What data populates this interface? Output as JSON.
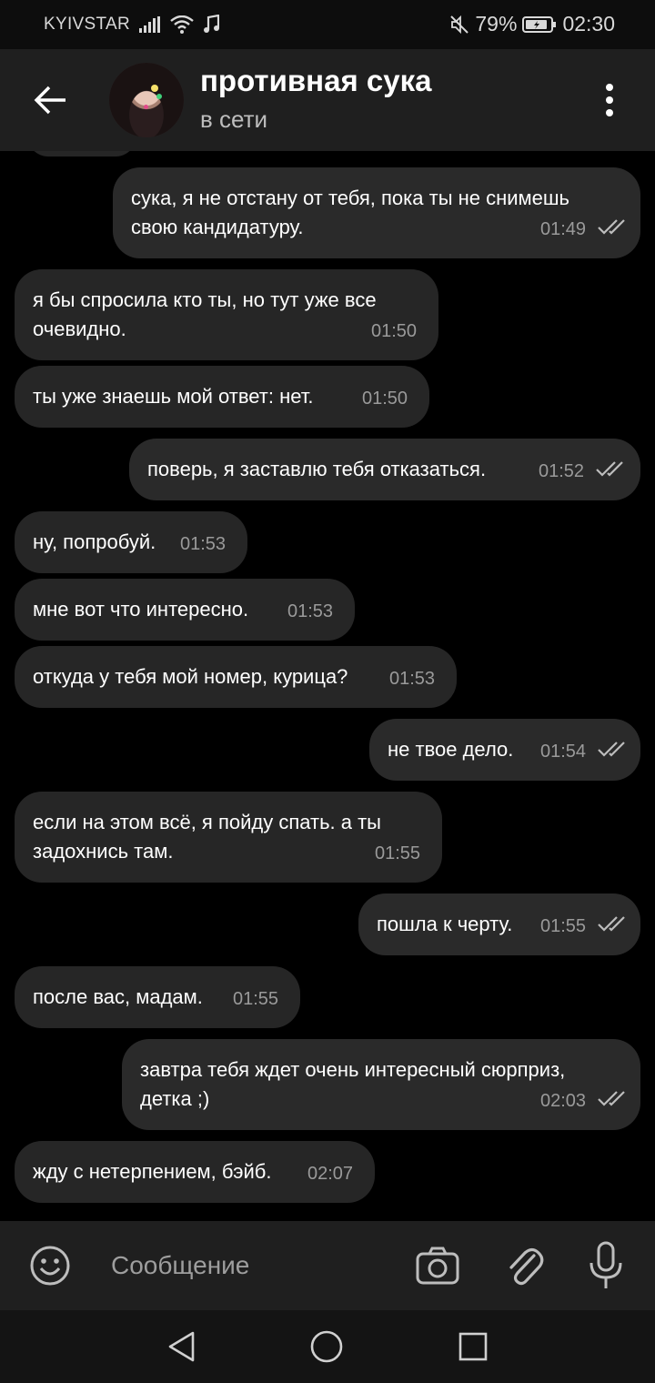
{
  "status_bar": {
    "carrier": "KYIVSTAR",
    "battery": "79%",
    "time": "02:30"
  },
  "header": {
    "contact_name": "противная сука",
    "status": "в сети"
  },
  "messages": [
    {
      "side": "out",
      "text": "сука, я не отстану от тебя, пока ты не снимешь\nсвою кандидатуру.",
      "time": "01:49",
      "read": true
    },
    {
      "side": "in",
      "text": "я бы спросила кто ты, но тут уже все\nочевидно.",
      "time": "01:50"
    },
    {
      "side": "in",
      "text": "ты уже знаешь мой ответ: нет.",
      "time": "01:50"
    },
    {
      "side": "out",
      "text": "поверь, я заставлю тебя отказаться.",
      "time": "01:52",
      "read": true
    },
    {
      "side": "in",
      "text": "ну, попробуй.",
      "time": "01:53"
    },
    {
      "side": "in",
      "text": "мне вот что интересно.",
      "time": "01:53"
    },
    {
      "side": "in",
      "text": "откуда у тебя мой номер, курица?",
      "time": "01:53"
    },
    {
      "side": "out",
      "text": "не твое дело.",
      "time": "01:54",
      "read": true
    },
    {
      "side": "in",
      "text": "если на этом всё, я пойду спать. а ты\nзадохнись там.",
      "time": "01:55"
    },
    {
      "side": "out",
      "text": "пошла к черту.",
      "time": "01:55",
      "read": true
    },
    {
      "side": "in",
      "text": "после вас, мадам.",
      "time": "01:55"
    },
    {
      "side": "out",
      "text": "завтра тебя ждет очень интересный сюрприз,\nдетка ;)",
      "time": "02:03",
      "read": true
    },
    {
      "side": "in",
      "text": "жду с нетерпением, бэйб.",
      "time": "02:07"
    }
  ],
  "input": {
    "placeholder": "Сообщение"
  },
  "icons": {
    "back": "arrow-left-icon",
    "menu": "more-vertical-icon",
    "emoji": "emoji-icon",
    "camera": "camera-icon",
    "attach": "paperclip-icon",
    "mic": "microphone-icon",
    "read_receipt": "double-check-icon"
  },
  "colors": {
    "background": "#000000",
    "header": "#1f1f1f",
    "bubble": "#262626",
    "time_text": "#9a9a9a"
  }
}
